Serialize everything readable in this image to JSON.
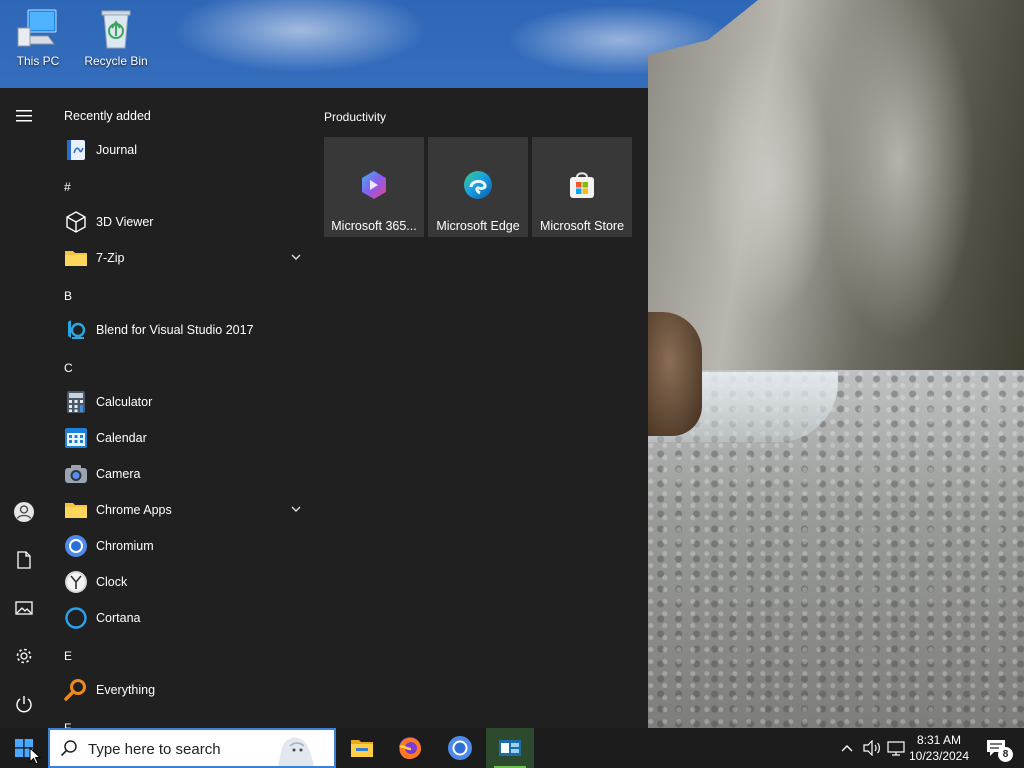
{
  "desktop": {
    "icons": [
      {
        "label": "This PC",
        "icon": "computer-icon"
      },
      {
        "label": "Recycle Bin",
        "icon": "recycle-bin-icon"
      }
    ]
  },
  "start_menu": {
    "list_header": "Recently added",
    "tiles_title": "Productivity",
    "apps": [
      {
        "type": "app",
        "label": "Journal",
        "icon": "journal-icon"
      },
      {
        "type": "header",
        "label": "#"
      },
      {
        "type": "app",
        "label": "3D Viewer",
        "icon": "cube-icon"
      },
      {
        "type": "folder",
        "label": "7-Zip",
        "icon": "folder-icon"
      },
      {
        "type": "header",
        "label": "B"
      },
      {
        "type": "app",
        "label": "Blend for Visual Studio 2017",
        "icon": "blend-icon"
      },
      {
        "type": "header",
        "label": "C"
      },
      {
        "type": "app",
        "label": "Calculator",
        "icon": "calculator-icon"
      },
      {
        "type": "app",
        "label": "Calendar",
        "icon": "calendar-icon"
      },
      {
        "type": "app",
        "label": "Camera",
        "icon": "camera-icon"
      },
      {
        "type": "folder",
        "label": "Chrome Apps",
        "icon": "folder-icon"
      },
      {
        "type": "app",
        "label": "Chromium",
        "icon": "chromium-icon"
      },
      {
        "type": "app",
        "label": "Clock",
        "icon": "clock-icon"
      },
      {
        "type": "app",
        "label": "Cortana",
        "icon": "cortana-icon"
      },
      {
        "type": "header",
        "label": "E"
      },
      {
        "type": "app",
        "label": "Everything",
        "icon": "everything-icon"
      },
      {
        "type": "header",
        "label": "F"
      }
    ],
    "tiles": [
      {
        "label": "Microsoft 365...",
        "icon": "microsoft-365-icon"
      },
      {
        "label": "Microsoft Edge",
        "icon": "edge-icon"
      },
      {
        "label": "Microsoft Store",
        "icon": "store-icon"
      }
    ],
    "rail": [
      "menu-icon",
      "user-icon",
      "documents-icon",
      "pictures-icon",
      "settings-icon",
      "power-icon"
    ]
  },
  "taskbar": {
    "search_placeholder": "Type here to search",
    "time": "8:31 AM",
    "date": "10/23/2024",
    "notification_count": "8",
    "pinned": [
      "file-explorer-icon",
      "firefox-icon",
      "chromium-icon",
      "app-icon"
    ]
  },
  "colors": {
    "menu_bg": "#202020",
    "tile_bg": "#383838",
    "taskbar_bg": "#1c1c1c",
    "accent": "#0078d7"
  }
}
